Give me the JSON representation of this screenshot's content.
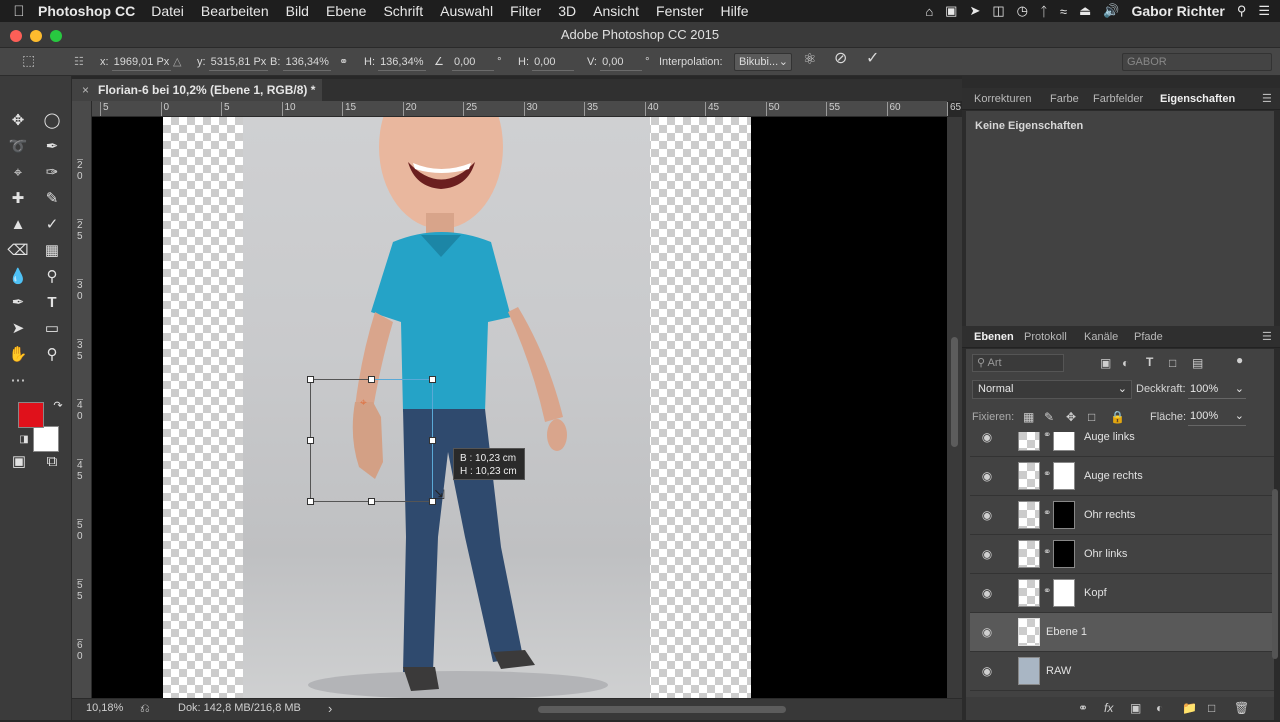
{
  "menubar": {
    "app": "Photoshop CC",
    "menus": [
      "Datei",
      "Bearbeiten",
      "Bild",
      "Ebene",
      "Schrift",
      "Auswahl",
      "Filter",
      "3D",
      "Ansicht",
      "Fenster",
      "Hilfe"
    ],
    "user": "Gabor Richter"
  },
  "window": {
    "title": "Adobe Photoshop CC 2015"
  },
  "options": {
    "x_label": "x:",
    "x_value": "1969,01 Px",
    "y_label": "y:",
    "y_value": "5315,81 Px",
    "b_label": "B:",
    "b_value": "136,34%",
    "h_label": "H:",
    "h_value": "136,34%",
    "angle_value": "0,00",
    "angle_unit": "°",
    "hskew_label": "H:",
    "hskew_value": "0,00",
    "vskew_label": "V:",
    "vskew_value": "0,00",
    "skew_unit": "°",
    "interp_label": "Interpolation:",
    "interp_value": "Bikubi...",
    "workspace": "GABOR"
  },
  "document": {
    "tab_title": "Florian-6 bei 10,2% (Ebene 1, RGB/8) *",
    "close": "×",
    "hruler_labels": [
      "5",
      "0",
      "5",
      "10",
      "15",
      "20",
      "25",
      "30",
      "35",
      "40",
      "45",
      "50",
      "55",
      "60",
      "65"
    ],
    "vruler_labels": [
      "2\n0",
      "2\n5",
      "3\n0",
      "3\n5",
      "4\n0",
      "4\n5",
      "5\n0",
      "5\n5",
      "6\n0",
      "6\n5"
    ],
    "transform_tooltip": {
      "b": "B : 10,23 cm",
      "h": "H : 10,23 cm"
    }
  },
  "status": {
    "zoom": "10,18%",
    "doc_info": "Dok: 142,8 MB/216,8 MB",
    "arrow": "›"
  },
  "colors": {
    "foreground": "#e0111b",
    "background": "#ffffff",
    "selection": "#5aa9d6"
  },
  "panels": {
    "top_tabs": [
      "Korrekturen",
      "Farbe",
      "Farbfelder",
      "Eigenschaften"
    ],
    "properties_text": "Keine Eigenschaften",
    "layer_tabs": [
      "Ebenen",
      "Protokoll",
      "Kanäle",
      "Pfade"
    ],
    "filter_placeholder": "Art",
    "blend_mode": "Normal",
    "opacity_label": "Deckkraft:",
    "opacity_value": "100%",
    "lock_label": "Fixieren:",
    "fill_label": "Fläche:",
    "fill_value": "100%",
    "layers": [
      {
        "name": "Auge links",
        "visible": true,
        "mask": true
      },
      {
        "name": "Auge rechts",
        "visible": true,
        "mask": true
      },
      {
        "name": "Ohr rechts",
        "visible": true,
        "mask": true
      },
      {
        "name": "Ohr links",
        "visible": true,
        "mask": true
      },
      {
        "name": "Kopf",
        "visible": true,
        "mask": true
      },
      {
        "name": "Ebene 1",
        "visible": true,
        "mask": false,
        "selected": true
      },
      {
        "name": "RAW",
        "visible": true,
        "mask": false
      }
    ]
  }
}
